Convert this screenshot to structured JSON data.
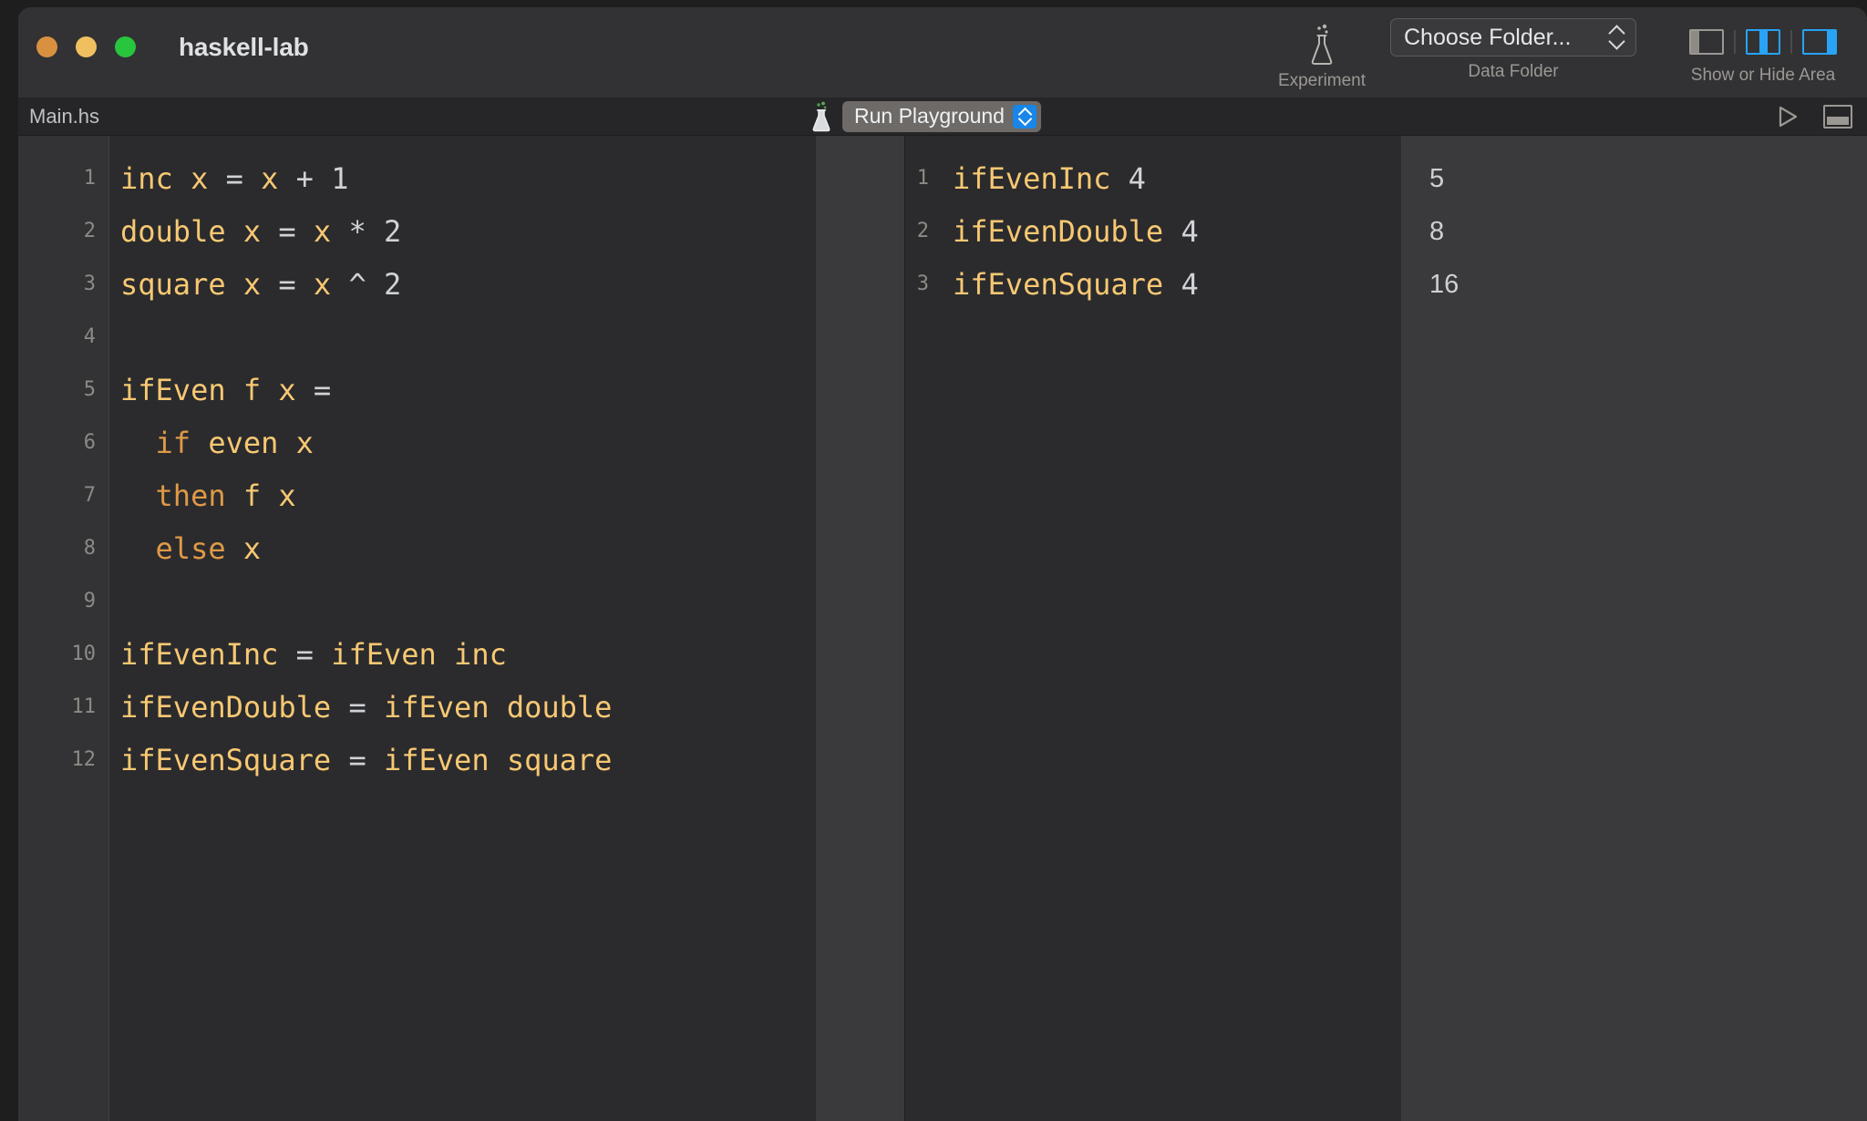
{
  "window": {
    "title": "haskell-lab",
    "traffic_lights": [
      {
        "name": "close",
        "color": "#d9913f"
      },
      {
        "name": "minimize",
        "color": "#f0c060"
      },
      {
        "name": "zoom",
        "color": "#28c53f"
      }
    ]
  },
  "toolbar": {
    "experiment": {
      "icon": "flask-icon",
      "caption": "Experiment"
    },
    "data_folder": {
      "button_label": "Choose Folder...",
      "caption": "Data Folder",
      "icon": "chevron-up-down-icon"
    },
    "show_hide_area": {
      "caption": "Show or Hide Area",
      "toggles": [
        {
          "name": "left-panel",
          "active": false,
          "bar": "left",
          "color": "#8e8b87"
        },
        {
          "name": "center-panel",
          "active": true,
          "bar": "center",
          "color": "#28a3f5"
        },
        {
          "name": "right-panel",
          "active": true,
          "bar": "right",
          "color": "#28a3f5"
        }
      ]
    }
  },
  "editor_bar": {
    "filename": "Main.hs",
    "playground_icon": "flask-icon",
    "run_mode_label": "Run Playground",
    "run_button_icon": "play-triangle-icon",
    "console_toggle_icon": "console-icon"
  },
  "editor": {
    "line_numbers": [
      "1",
      "2",
      "3",
      "4",
      "5",
      "6",
      "7",
      "8",
      "9",
      "10",
      "11",
      "12"
    ],
    "lines": [
      [
        {
          "t": "inc",
          "c": "id"
        },
        {
          "t": " ",
          "c": "op"
        },
        {
          "t": "x",
          "c": "id"
        },
        {
          "t": " ",
          "c": "op"
        },
        {
          "t": "=",
          "c": "op"
        },
        {
          "t": " ",
          "c": "op"
        },
        {
          "t": "x",
          "c": "id"
        },
        {
          "t": " ",
          "c": "op"
        },
        {
          "t": "+",
          "c": "op"
        },
        {
          "t": " ",
          "c": "op"
        },
        {
          "t": "1",
          "c": "num"
        }
      ],
      [
        {
          "t": "double",
          "c": "id"
        },
        {
          "t": " ",
          "c": "op"
        },
        {
          "t": "x",
          "c": "id"
        },
        {
          "t": " ",
          "c": "op"
        },
        {
          "t": "=",
          "c": "op"
        },
        {
          "t": " ",
          "c": "op"
        },
        {
          "t": "x",
          "c": "id"
        },
        {
          "t": " ",
          "c": "op"
        },
        {
          "t": "*",
          "c": "op"
        },
        {
          "t": " ",
          "c": "op"
        },
        {
          "t": "2",
          "c": "num"
        }
      ],
      [
        {
          "t": "square",
          "c": "id"
        },
        {
          "t": " ",
          "c": "op"
        },
        {
          "t": "x",
          "c": "id"
        },
        {
          "t": " ",
          "c": "op"
        },
        {
          "t": "=",
          "c": "op"
        },
        {
          "t": " ",
          "c": "op"
        },
        {
          "t": "x",
          "c": "id"
        },
        {
          "t": " ",
          "c": "op"
        },
        {
          "t": "^",
          "c": "op"
        },
        {
          "t": " ",
          "c": "op"
        },
        {
          "t": "2",
          "c": "num"
        }
      ],
      [],
      [
        {
          "t": "ifEven",
          "c": "id"
        },
        {
          "t": " ",
          "c": "op"
        },
        {
          "t": "f",
          "c": "id"
        },
        {
          "t": " ",
          "c": "op"
        },
        {
          "t": "x",
          "c": "id"
        },
        {
          "t": " ",
          "c": "op"
        },
        {
          "t": "=",
          "c": "op"
        }
      ],
      [
        {
          "t": "  ",
          "c": "op"
        },
        {
          "t": "if",
          "c": "kw"
        },
        {
          "t": " ",
          "c": "op"
        },
        {
          "t": "even",
          "c": "id"
        },
        {
          "t": " ",
          "c": "op"
        },
        {
          "t": "x",
          "c": "id"
        }
      ],
      [
        {
          "t": "  ",
          "c": "op"
        },
        {
          "t": "then",
          "c": "kw"
        },
        {
          "t": " ",
          "c": "op"
        },
        {
          "t": "f",
          "c": "id"
        },
        {
          "t": " ",
          "c": "op"
        },
        {
          "t": "x",
          "c": "id"
        }
      ],
      [
        {
          "t": "  ",
          "c": "op"
        },
        {
          "t": "else",
          "c": "kw"
        },
        {
          "t": " ",
          "c": "op"
        },
        {
          "t": "x",
          "c": "id"
        }
      ],
      [],
      [
        {
          "t": "ifEvenInc",
          "c": "id"
        },
        {
          "t": " ",
          "c": "op"
        },
        {
          "t": "=",
          "c": "op"
        },
        {
          "t": " ",
          "c": "op"
        },
        {
          "t": "ifEven",
          "c": "id"
        },
        {
          "t": " ",
          "c": "op"
        },
        {
          "t": "inc",
          "c": "id"
        }
      ],
      [
        {
          "t": "ifEvenDouble",
          "c": "id"
        },
        {
          "t": " ",
          "c": "op"
        },
        {
          "t": "=",
          "c": "op"
        },
        {
          "t": " ",
          "c": "op"
        },
        {
          "t": "ifEven",
          "c": "id"
        },
        {
          "t": " ",
          "c": "op"
        },
        {
          "t": "double",
          "c": "id"
        }
      ],
      [
        {
          "t": "ifEvenSquare",
          "c": "id"
        },
        {
          "t": " ",
          "c": "op"
        },
        {
          "t": "=",
          "c": "op"
        },
        {
          "t": " ",
          "c": "op"
        },
        {
          "t": "ifEven",
          "c": "id"
        },
        {
          "t": " ",
          "c": "op"
        },
        {
          "t": "square",
          "c": "id"
        }
      ]
    ]
  },
  "playground": {
    "line_numbers": [
      "1",
      "2",
      "3"
    ],
    "lines": [
      [
        {
          "t": "ifEvenInc",
          "c": "id"
        },
        {
          "t": " ",
          "c": "op"
        },
        {
          "t": "4",
          "c": "num"
        }
      ],
      [
        {
          "t": "ifEvenDouble",
          "c": "id"
        },
        {
          "t": " ",
          "c": "op"
        },
        {
          "t": "4",
          "c": "num"
        }
      ],
      [
        {
          "t": "ifEvenSquare",
          "c": "id"
        },
        {
          "t": " ",
          "c": "op"
        },
        {
          "t": "4",
          "c": "num"
        }
      ]
    ],
    "results": [
      "5",
      "8",
      "16"
    ]
  },
  "colors": {
    "identifier": "#f7c873",
    "keyword": "#df9a47",
    "operator": "#cfd2d6",
    "number": "#cfd2d6",
    "accent_blue": "#28a3f5",
    "editor_bg": "#2b2b2d",
    "results_bg": "#3a3a3c",
    "chrome_bg": "#323234"
  }
}
